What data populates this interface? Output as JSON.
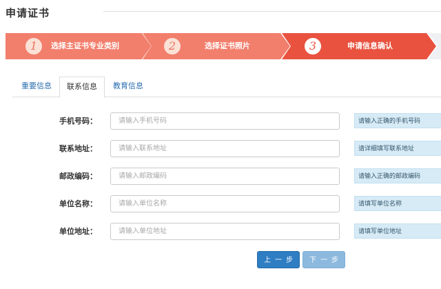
{
  "page": {
    "title": "申请证书"
  },
  "steps": [
    {
      "number": "1",
      "label": "选择主证书专业类别"
    },
    {
      "number": "2",
      "label": "选择证书照片"
    },
    {
      "number": "3",
      "label": "申请信息确认"
    }
  ],
  "tabs": [
    {
      "label": "重要信息"
    },
    {
      "label": "联系信息"
    },
    {
      "label": "教育信息"
    }
  ],
  "form": {
    "fields": [
      {
        "label": "手机号码：",
        "placeholder": "请输入手机号码",
        "hint": "请输入正确的手机号码"
      },
      {
        "label": "联系地址：",
        "placeholder": "请输入联系地址",
        "hint": "请详细填写联系地址"
      },
      {
        "label": "邮政编码：",
        "placeholder": "请输入邮政编码",
        "hint": "请输入正确的邮政编码"
      },
      {
        "label": "单位名称：",
        "placeholder": "请输入单位名称",
        "hint": "请填写单位名称"
      },
      {
        "label": "单位地址：",
        "placeholder": "请输入单位地址",
        "hint": "请填写单位地址"
      }
    ]
  },
  "buttons": {
    "prev_label": "上一步",
    "next_label": "下一步"
  },
  "colors": {
    "step_done": "#f27e6c",
    "step_active": "#e8523f",
    "step_pending": "#eef0f3",
    "tab_link": "#2a6eb0",
    "hint_bg": "#d6ebf6",
    "btn_primary": "#2f7dc2",
    "btn_disabled": "#8db9de"
  }
}
